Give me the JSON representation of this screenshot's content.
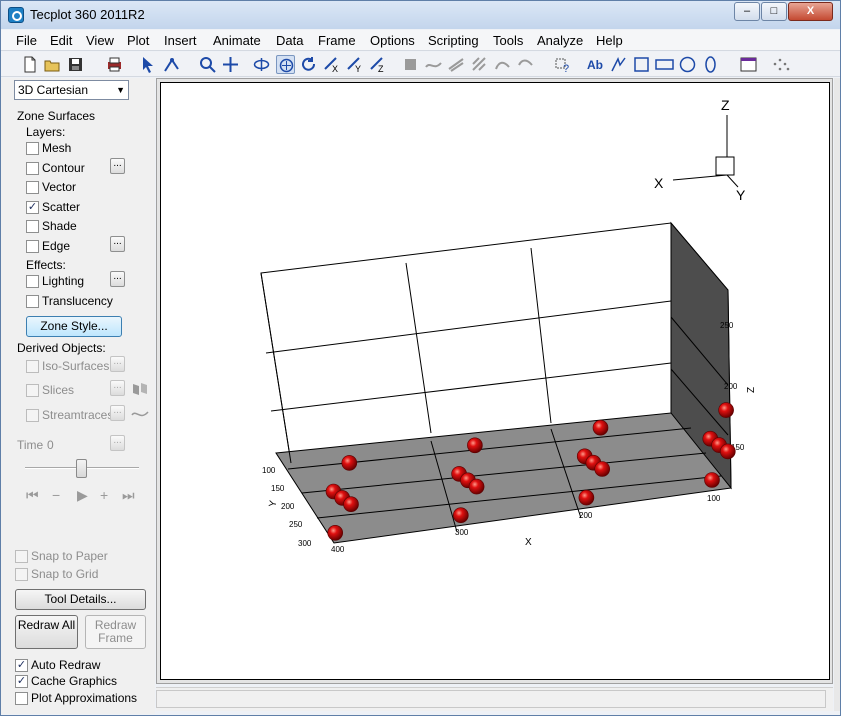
{
  "window": {
    "title": "Tecplot 360 2011R2"
  },
  "window_controls": {
    "minimize": "–",
    "maximize": "□",
    "close": "X"
  },
  "menu": [
    "File",
    "Edit",
    "View",
    "Plot",
    "Insert",
    "Animate",
    "Data",
    "Frame",
    "Options",
    "Scripting",
    "Tools",
    "Analyze",
    "Help"
  ],
  "toolbar_icons": [
    "new-file-icon",
    "open-folder-icon",
    "save-icon",
    "print-icon",
    "select-arrow-icon",
    "adjustor-icon",
    "zoom-icon",
    "translate-icon",
    "rotate-spherical-icon",
    "rotate-rollerball-icon",
    "rotate-twist-icon",
    "rotate-x-icon",
    "rotate-y-icon",
    "rotate-z-icon",
    "probe-icon",
    "streamtrace-icon",
    "slice-icon",
    "isosurface-icon",
    "contour-add-icon",
    "geometry-help-icon",
    "text-icon",
    "polyline-icon",
    "square-icon",
    "rectangle-icon",
    "circle-icon",
    "ellipse-icon",
    "frame-icon",
    "dots-icon"
  ],
  "sidebar": {
    "plot_type": "3D Cartesian",
    "zone_surfaces_label": "Zone Surfaces",
    "layers_label": "Layers:",
    "layers": [
      {
        "label": "Mesh",
        "checked": false,
        "has_options": false
      },
      {
        "label": "Contour",
        "checked": false,
        "has_options": true
      },
      {
        "label": "Vector",
        "checked": false,
        "has_options": false
      },
      {
        "label": "Scatter",
        "checked": true,
        "has_options": false
      },
      {
        "label": "Shade",
        "checked": false,
        "has_options": false
      },
      {
        "label": "Edge",
        "checked": false,
        "has_options": true
      }
    ],
    "effects_label": "Effects:",
    "effects": [
      {
        "label": "Lighting",
        "checked": false,
        "has_options": true
      },
      {
        "label": "Translucency",
        "checked": false,
        "has_options": false
      }
    ],
    "zone_style_button": "Zone Style...",
    "derived_objects_label": "Derived Objects:",
    "derived": [
      {
        "label": "Iso-Surfaces"
      },
      {
        "label": "Slices"
      },
      {
        "label": "Streamtraces"
      }
    ],
    "options_button": "...",
    "time_label": "Time",
    "time_value": "0",
    "snap_to_paper": "Snap to Paper",
    "snap_to_grid": "Snap to Grid",
    "tool_details_button": "Tool Details...",
    "redraw_all_button": "Redraw All",
    "redraw_frame_button": "Redraw Frame",
    "auto_redraw": {
      "label": "Auto Redraw",
      "checked": true
    },
    "cache_graphics": {
      "label": "Cache Graphics",
      "checked": true
    },
    "plot_approximations": {
      "label": "Plot Approximations",
      "checked": false
    }
  },
  "plot": {
    "orientation_axis_labels": {
      "x": "X",
      "y": "Y",
      "z": "Z"
    },
    "x_axis_title": "X",
    "y_axis_title": "Y",
    "z_axis_title": "Z",
    "x_ticks": [
      "100",
      "200",
      "300",
      "400"
    ],
    "y_ticks": [
      "100",
      "150",
      "200",
      "250",
      "300"
    ],
    "z_ticks": [
      "150",
      "200",
      "250"
    ]
  },
  "chart_data": {
    "type": "scatter",
    "title": "",
    "xlabel": "X",
    "ylabel": "Y",
    "zlabel": "Z",
    "symbol": "red sphere",
    "symbol_color": "#cc0000",
    "x": [
      400,
      400,
      400,
      400,
      400,
      300,
      300,
      300,
      300,
      300,
      200,
      200,
      200,
      200,
      200,
      100,
      100,
      100,
      100,
      100
    ],
    "y": [
      300,
      300,
      200,
      100,
      100,
      300,
      300,
      200,
      100,
      100,
      300,
      300,
      200,
      100,
      100,
      300,
      300,
      200,
      100,
      100
    ],
    "z": [
      275,
      225,
      200,
      175,
      125,
      275,
      225,
      200,
      175,
      125,
      275,
      225,
      200,
      175,
      125,
      275,
      225,
      200,
      175,
      125
    ]
  }
}
